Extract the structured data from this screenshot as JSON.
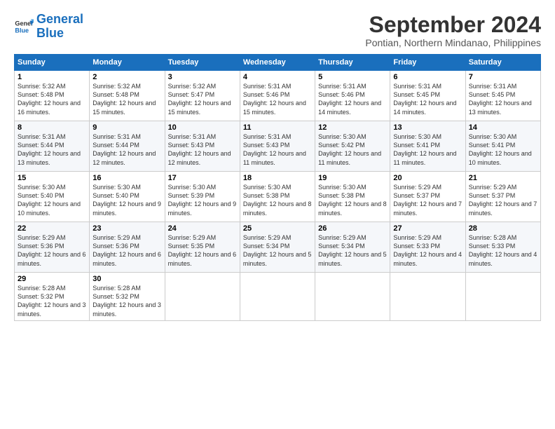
{
  "logo": {
    "line1": "General",
    "line2": "Blue"
  },
  "title": "September 2024",
  "subtitle": "Pontian, Northern Mindanao, Philippines",
  "header_days": [
    "Sunday",
    "Monday",
    "Tuesday",
    "Wednesday",
    "Thursday",
    "Friday",
    "Saturday"
  ],
  "weeks": [
    [
      {
        "day": "1",
        "sunrise": "Sunrise: 5:32 AM",
        "sunset": "Sunset: 5:48 PM",
        "daylight": "Daylight: 12 hours and 16 minutes."
      },
      {
        "day": "2",
        "sunrise": "Sunrise: 5:32 AM",
        "sunset": "Sunset: 5:48 PM",
        "daylight": "Daylight: 12 hours and 15 minutes."
      },
      {
        "day": "3",
        "sunrise": "Sunrise: 5:32 AM",
        "sunset": "Sunset: 5:47 PM",
        "daylight": "Daylight: 12 hours and 15 minutes."
      },
      {
        "day": "4",
        "sunrise": "Sunrise: 5:31 AM",
        "sunset": "Sunset: 5:46 PM",
        "daylight": "Daylight: 12 hours and 15 minutes."
      },
      {
        "day": "5",
        "sunrise": "Sunrise: 5:31 AM",
        "sunset": "Sunset: 5:46 PM",
        "daylight": "Daylight: 12 hours and 14 minutes."
      },
      {
        "day": "6",
        "sunrise": "Sunrise: 5:31 AM",
        "sunset": "Sunset: 5:45 PM",
        "daylight": "Daylight: 12 hours and 14 minutes."
      },
      {
        "day": "7",
        "sunrise": "Sunrise: 5:31 AM",
        "sunset": "Sunset: 5:45 PM",
        "daylight": "Daylight: 12 hours and 13 minutes."
      }
    ],
    [
      {
        "day": "8",
        "sunrise": "Sunrise: 5:31 AM",
        "sunset": "Sunset: 5:44 PM",
        "daylight": "Daylight: 12 hours and 13 minutes."
      },
      {
        "day": "9",
        "sunrise": "Sunrise: 5:31 AM",
        "sunset": "Sunset: 5:44 PM",
        "daylight": "Daylight: 12 hours and 12 minutes."
      },
      {
        "day": "10",
        "sunrise": "Sunrise: 5:31 AM",
        "sunset": "Sunset: 5:43 PM",
        "daylight": "Daylight: 12 hours and 12 minutes."
      },
      {
        "day": "11",
        "sunrise": "Sunrise: 5:31 AM",
        "sunset": "Sunset: 5:43 PM",
        "daylight": "Daylight: 12 hours and 11 minutes."
      },
      {
        "day": "12",
        "sunrise": "Sunrise: 5:30 AM",
        "sunset": "Sunset: 5:42 PM",
        "daylight": "Daylight: 12 hours and 11 minutes."
      },
      {
        "day": "13",
        "sunrise": "Sunrise: 5:30 AM",
        "sunset": "Sunset: 5:41 PM",
        "daylight": "Daylight: 12 hours and 11 minutes."
      },
      {
        "day": "14",
        "sunrise": "Sunrise: 5:30 AM",
        "sunset": "Sunset: 5:41 PM",
        "daylight": "Daylight: 12 hours and 10 minutes."
      }
    ],
    [
      {
        "day": "15",
        "sunrise": "Sunrise: 5:30 AM",
        "sunset": "Sunset: 5:40 PM",
        "daylight": "Daylight: 12 hours and 10 minutes."
      },
      {
        "day": "16",
        "sunrise": "Sunrise: 5:30 AM",
        "sunset": "Sunset: 5:40 PM",
        "daylight": "Daylight: 12 hours and 9 minutes."
      },
      {
        "day": "17",
        "sunrise": "Sunrise: 5:30 AM",
        "sunset": "Sunset: 5:39 PM",
        "daylight": "Daylight: 12 hours and 9 minutes."
      },
      {
        "day": "18",
        "sunrise": "Sunrise: 5:30 AM",
        "sunset": "Sunset: 5:38 PM",
        "daylight": "Daylight: 12 hours and 8 minutes."
      },
      {
        "day": "19",
        "sunrise": "Sunrise: 5:30 AM",
        "sunset": "Sunset: 5:38 PM",
        "daylight": "Daylight: 12 hours and 8 minutes."
      },
      {
        "day": "20",
        "sunrise": "Sunrise: 5:29 AM",
        "sunset": "Sunset: 5:37 PM",
        "daylight": "Daylight: 12 hours and 7 minutes."
      },
      {
        "day": "21",
        "sunrise": "Sunrise: 5:29 AM",
        "sunset": "Sunset: 5:37 PM",
        "daylight": "Daylight: 12 hours and 7 minutes."
      }
    ],
    [
      {
        "day": "22",
        "sunrise": "Sunrise: 5:29 AM",
        "sunset": "Sunset: 5:36 PM",
        "daylight": "Daylight: 12 hours and 6 minutes."
      },
      {
        "day": "23",
        "sunrise": "Sunrise: 5:29 AM",
        "sunset": "Sunset: 5:36 PM",
        "daylight": "Daylight: 12 hours and 6 minutes."
      },
      {
        "day": "24",
        "sunrise": "Sunrise: 5:29 AM",
        "sunset": "Sunset: 5:35 PM",
        "daylight": "Daylight: 12 hours and 6 minutes."
      },
      {
        "day": "25",
        "sunrise": "Sunrise: 5:29 AM",
        "sunset": "Sunset: 5:34 PM",
        "daylight": "Daylight: 12 hours and 5 minutes."
      },
      {
        "day": "26",
        "sunrise": "Sunrise: 5:29 AM",
        "sunset": "Sunset: 5:34 PM",
        "daylight": "Daylight: 12 hours and 5 minutes."
      },
      {
        "day": "27",
        "sunrise": "Sunrise: 5:29 AM",
        "sunset": "Sunset: 5:33 PM",
        "daylight": "Daylight: 12 hours and 4 minutes."
      },
      {
        "day": "28",
        "sunrise": "Sunrise: 5:28 AM",
        "sunset": "Sunset: 5:33 PM",
        "daylight": "Daylight: 12 hours and 4 minutes."
      }
    ],
    [
      {
        "day": "29",
        "sunrise": "Sunrise: 5:28 AM",
        "sunset": "Sunset: 5:32 PM",
        "daylight": "Daylight: 12 hours and 3 minutes."
      },
      {
        "day": "30",
        "sunrise": "Sunrise: 5:28 AM",
        "sunset": "Sunset: 5:32 PM",
        "daylight": "Daylight: 12 hours and 3 minutes."
      },
      null,
      null,
      null,
      null,
      null
    ]
  ]
}
